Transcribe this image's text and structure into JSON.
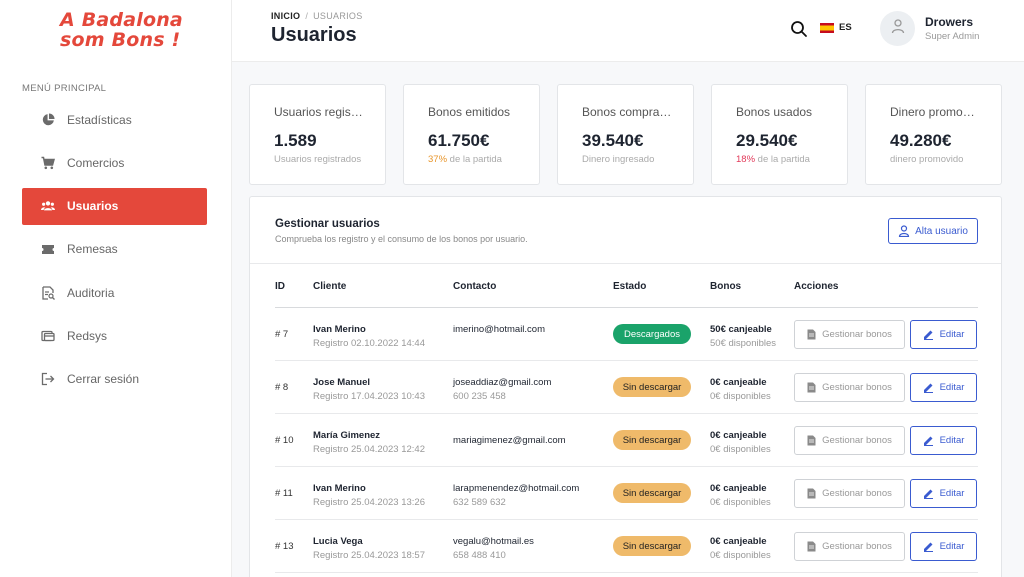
{
  "sidebar": {
    "logo_line1": "A Badalona",
    "logo_line2": "som Bons !",
    "menu_title": "MENÚ PRINCIPAL",
    "items": [
      {
        "label": "Estadísticas",
        "icon": "pie-chart-icon"
      },
      {
        "label": "Comercios",
        "icon": "cart-icon"
      },
      {
        "label": "Usuarios",
        "icon": "users-icon",
        "active": true
      },
      {
        "label": "Remesas",
        "icon": "ticket-icon"
      },
      {
        "label": "Auditoria",
        "icon": "audit-document-icon"
      },
      {
        "label": "Redsys",
        "icon": "card-icon"
      },
      {
        "label": "Cerrar sesión",
        "icon": "logout-icon"
      }
    ]
  },
  "header": {
    "breadcrumb_home": "INICIO",
    "breadcrumb_sep": "/",
    "breadcrumb_current": "USUARIOS",
    "title": "Usuarios",
    "language": "ES",
    "user_name": "Drowers",
    "user_role": "Super Admin"
  },
  "stats": [
    {
      "label": "Usuarios registrados",
      "value": "1.589",
      "pct": "",
      "sub": "Usuarios registrados"
    },
    {
      "label": "Bonos emitidos",
      "value": "61.750€",
      "pct": "37%",
      "sub": " de la partida"
    },
    {
      "label": "Bonos comprados",
      "value": "39.540€",
      "pct": "",
      "sub": "Dinero ingresado"
    },
    {
      "label": "Bonos usados",
      "value": "29.540€",
      "pct": "18%",
      "sub": " de la partida"
    },
    {
      "label": "Dinero promovido",
      "value": "49.280€",
      "pct": "",
      "sub": "dinero promovido"
    }
  ],
  "panel": {
    "title": "Gestionar usuarios",
    "subtitle": "Comprueba los registro y el consumo de los bonos por usuario.",
    "add_button": "Alta usuario",
    "columns": [
      "ID",
      "Cliente",
      "Contacto",
      "Estado",
      "Bonos",
      "Acciones"
    ],
    "gestionar_label": "Gestionar bonos",
    "editar_label": "Editar",
    "rows": [
      {
        "id": "# 7",
        "name": "Ivan Merino",
        "registered": "Registro 02.10.2022 14:44",
        "email": "imerino@hotmail.com",
        "phone": "",
        "status": "Descargados",
        "status_color": "#1aa36a",
        "canjeable": "50€ canjeable",
        "disponibles": "50€ disponibles"
      },
      {
        "id": "# 8",
        "name": "Jose Manuel",
        "registered": "Registro 17.04.2023 10:43",
        "email": "joseaddiaz@gmail.com",
        "phone": "600 235 458",
        "status": "Sin descargar",
        "status_color": "#efba6a",
        "canjeable": "0€ canjeable",
        "disponibles": "0€ disponibles"
      },
      {
        "id": "# 10",
        "name": "María Gimenez",
        "registered": "Registro 25.04.2023 12:42",
        "email": "mariagimenez@gmail.com",
        "phone": "",
        "status": "Sin descargar",
        "status_color": "#efba6a",
        "canjeable": "0€ canjeable",
        "disponibles": "0€ disponibles"
      },
      {
        "id": "# 11",
        "name": "Ivan Merino",
        "registered": "Registro 25.04.2023 13:26",
        "email": "larapmenendez@hotmail.com",
        "phone": "632 589 632",
        "status": "Sin descargar",
        "status_color": "#efba6a",
        "canjeable": "0€ canjeable",
        "disponibles": "0€ disponibles"
      },
      {
        "id": "# 13",
        "name": "Lucia Vega",
        "registered": "Registro 25.04.2023 18:57",
        "email": "vegalu@hotmail.es",
        "phone": "658 488 410",
        "status": "Sin descargar",
        "status_color": "#efba6a",
        "canjeable": "0€ canjeable",
        "disponibles": "0€ disponibles"
      }
    ]
  },
  "colors": {
    "brand": "#e4483b",
    "primary": "#3a5bd0",
    "status_downloaded": "#1aa36a",
    "status_pending": "#efba6a"
  }
}
